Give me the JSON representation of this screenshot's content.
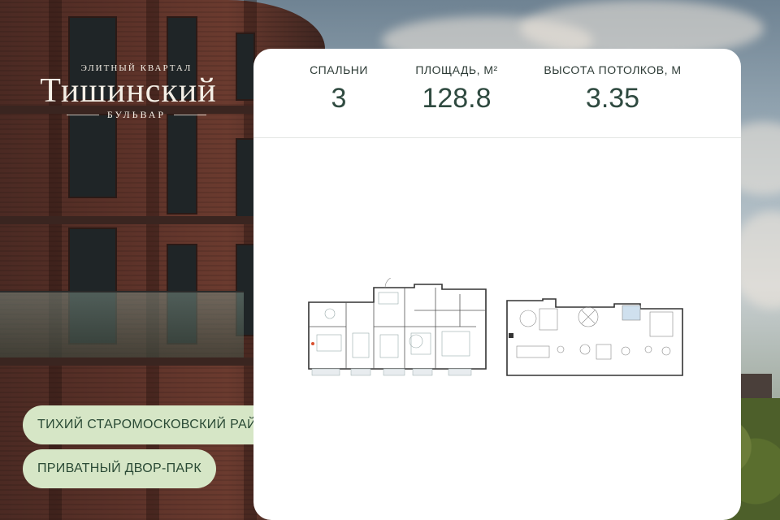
{
  "logo": {
    "tagline": "ЭЛИТНЫЙ КВАРТАЛ",
    "name": "Тишинский",
    "subname": "БУЛЬВАР"
  },
  "features": [
    "ТИХИЙ СТАРОМОСКОВСКИЙ РАЙОН",
    "ПРИВАТНЫЙ ДВОР-ПАРК"
  ],
  "stats": {
    "bedrooms_label": "СПАЛЬНИ",
    "bedrooms_value": "3",
    "area_label": "ПЛОЩАДЬ, М²",
    "area_value": "128.8",
    "ceiling_label": "ВЫСОТА ПОТОЛКОВ, М",
    "ceiling_value": "3.35"
  },
  "colors": {
    "pill_bg": "#d6e6c6",
    "pill_text": "#2a4a35",
    "card_bg": "#ffffff",
    "value_text": "#2f4a40"
  }
}
